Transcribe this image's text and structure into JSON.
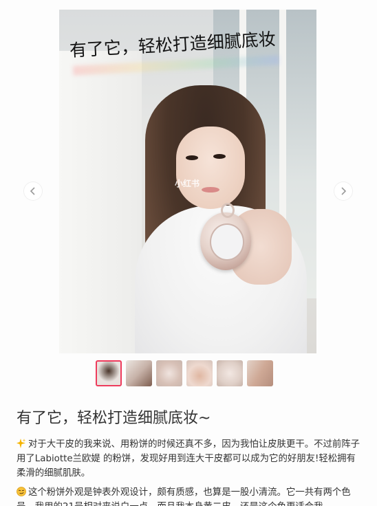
{
  "carousel": {
    "photo_title": "有了它，轻松打造细腻底妆",
    "watermark": "小红书",
    "prev_arrow": "chevron-left-icon",
    "next_arrow": "chevron-right-icon",
    "thumbnail_count": 6,
    "active_thumbnail": 1,
    "accent_color": "#ee3b5c"
  },
  "post": {
    "title": "有了它，轻松打造细腻底妆~",
    "paragraphs": [
      {
        "icon": "sparkle-icon",
        "text": "对于大干皮的我来说、用粉饼的时候还真不多，因为我怕让皮肤更干。不过前阵子用了Labiotte兰欧媞 的粉饼，发现好用到连大干皮都可以成为它的好朋友!轻松拥有柔滑的细腻肌肤。"
      },
      {
        "icon": "smirk-face-icon",
        "text": "这个粉饼外观是钟表外观设计，颇有质感，也算是一股小清流。它一共有两个色号，我用的21号相对来说白一点，而且我本身黄二皮，还是这个色更适合我"
      }
    ]
  }
}
